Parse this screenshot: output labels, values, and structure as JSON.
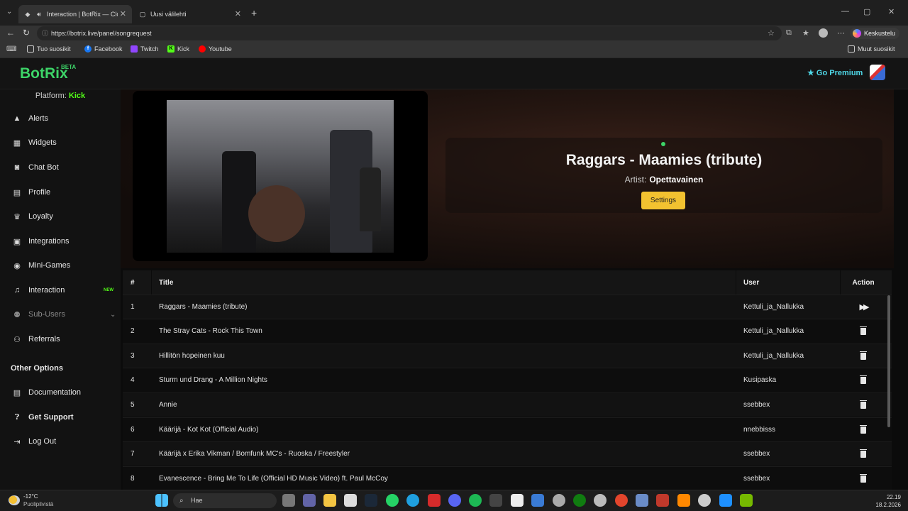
{
  "browser": {
    "tabs": [
      {
        "title": "Interaction | BotRix — Cloud",
        "active": true
      },
      {
        "title": "Uusi välilehti",
        "active": false
      }
    ],
    "url": "https://botrix.live/panel/songrequest",
    "chat_button": "Keskustelu",
    "bookmarks": [
      "Tuo suosikit",
      "Facebook",
      "Twitch",
      "Kick",
      "Youtube"
    ],
    "other_bookmarks": "Muut suosikit"
  },
  "app": {
    "logo": "BotRix",
    "beta": "BETA",
    "go_premium": "Go Premium",
    "platform_label": "Platform:",
    "platform_value": "Kick"
  },
  "sidebar": {
    "items": [
      {
        "label": "Alerts",
        "icon": "warning-icon"
      },
      {
        "label": "Widgets",
        "icon": "grid-icon"
      },
      {
        "label": "Chat Bot",
        "icon": "robot-icon"
      },
      {
        "label": "Profile",
        "icon": "id-card-icon"
      },
      {
        "label": "Loyalty",
        "icon": "trophy-icon"
      },
      {
        "label": "Integrations",
        "icon": "puzzle-icon"
      },
      {
        "label": "Mini-Games",
        "icon": "gamepad-icon"
      },
      {
        "label": "Interaction",
        "icon": "music-icon",
        "badge": "NEW"
      },
      {
        "label": "Sub-Users",
        "icon": "users-icon",
        "muted": true
      },
      {
        "label": "Referrals",
        "icon": "user-group-icon"
      }
    ],
    "other_options_heading": "Other Options",
    "other_items": [
      {
        "label": "Documentation",
        "icon": "docs-icon"
      },
      {
        "label": "Get Support",
        "icon": "question-icon"
      },
      {
        "label": "Log Out",
        "icon": "logout-icon"
      }
    ]
  },
  "now_playing": {
    "title": "Raggars - Maamies (tribute)",
    "artist_label": "Artist:",
    "artist": "Opettavainen",
    "settings_label": "Settings"
  },
  "queue": {
    "headers": {
      "num": "#",
      "title": "Title",
      "user": "User",
      "action": "Action"
    },
    "rows": [
      {
        "num": "1",
        "title": "Raggars - Maamies (tribute)",
        "user": "Kettuli_ja_Nallukka",
        "action": "skip"
      },
      {
        "num": "2",
        "title": "The Stray Cats - Rock This Town",
        "user": "Kettuli_ja_Nallukka",
        "action": "delete"
      },
      {
        "num": "3",
        "title": "Hillitön hopeinen kuu",
        "user": "Kettuli_ja_Nallukka",
        "action": "delete"
      },
      {
        "num": "4",
        "title": "Sturm und Drang - A Million Nights",
        "user": "Kusipaska",
        "action": "delete"
      },
      {
        "num": "5",
        "title": "Annie",
        "user": "ssebbex",
        "action": "delete"
      },
      {
        "num": "6",
        "title": "Käärijä - Kot Kot (Official Audio)",
        "user": "nnebbisss",
        "action": "delete"
      },
      {
        "num": "7",
        "title": "Käärijä x Erika Vikman / Bomfunk MC's - Ruoska / Freestyler",
        "user": "ssebbex",
        "action": "delete"
      },
      {
        "num": "8",
        "title": "Evanescence - Bring Me To Life (Official HD Music Video) ft. Paul McCoy",
        "user": "ssebbex",
        "action": "delete"
      }
    ]
  },
  "taskbar": {
    "temperature": "-12°C",
    "weather": "Puolipilvistä",
    "search_placeholder": "Hae",
    "time": "22.19",
    "date": "18.2.2026"
  },
  "colors": {
    "brand": "#3dd468",
    "premium": "#4fd8e8",
    "settings": "#f2c230",
    "kick": "#53fc18"
  }
}
